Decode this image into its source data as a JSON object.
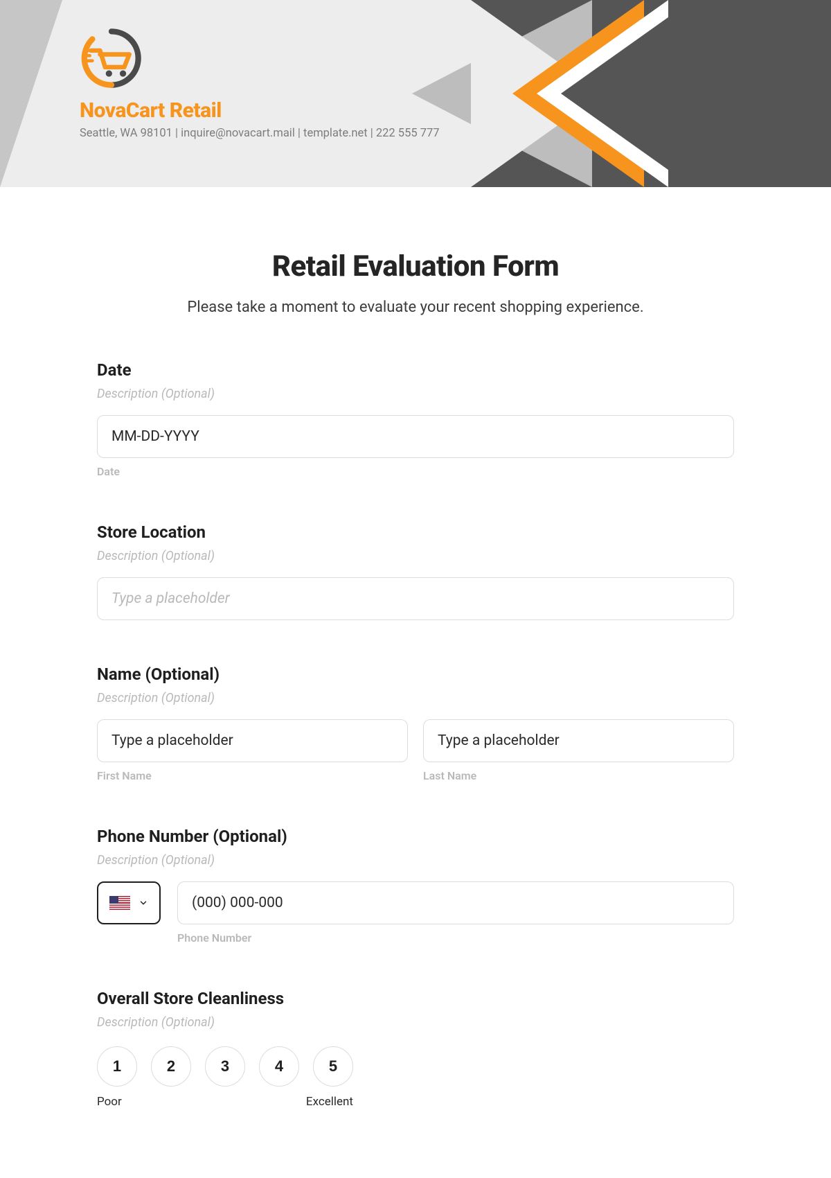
{
  "brand": {
    "name": "NovaCart Retail",
    "subline": "Seattle, WA 98101 | inquire@novacart.mail | template.net | 222 555 777"
  },
  "form": {
    "title": "Retail Evaluation Form",
    "subtitle": "Please take a moment to evaluate your recent shopping experience."
  },
  "fields": {
    "date": {
      "label": "Date",
      "desc": "Description (Optional)",
      "placeholder": "MM-DD-YYYY",
      "sublabel": "Date"
    },
    "store": {
      "label": "Store Location",
      "desc": "Description (Optional)",
      "placeholder": "Type a placeholder"
    },
    "name": {
      "label": "Name (Optional)",
      "desc": "Description (Optional)",
      "first_placeholder": "Type a placeholder",
      "first_sublabel": "First Name",
      "last_placeholder": "Type a placeholder",
      "last_sublabel": "Last Name"
    },
    "phone": {
      "label": "Phone Number (Optional)",
      "desc": "Description (Optional)",
      "placeholder": "(000) 000-000",
      "sublabel": "Phone Number"
    },
    "clean": {
      "label": "Overall Store Cleanliness",
      "desc": "Description (Optional)",
      "options": [
        "1",
        "2",
        "3",
        "4",
        "5"
      ],
      "low": "Poor",
      "high": "Excellent"
    }
  }
}
